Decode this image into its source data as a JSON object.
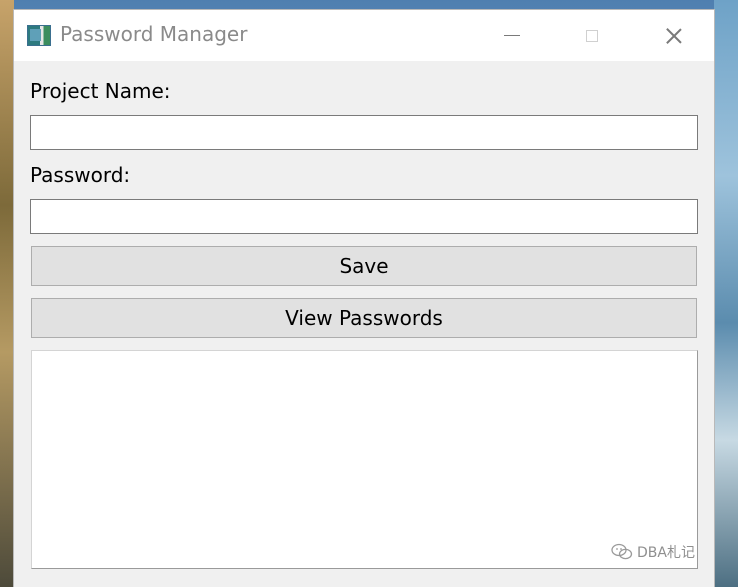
{
  "window": {
    "title": "Password Manager"
  },
  "form": {
    "project_label": "Project Name:",
    "project_value": "",
    "password_label": "Password:",
    "password_value": ""
  },
  "buttons": {
    "save_label": "Save",
    "view_label": "View Passwords"
  },
  "output": {
    "text": ""
  },
  "watermark": {
    "text": "DBA札记"
  }
}
